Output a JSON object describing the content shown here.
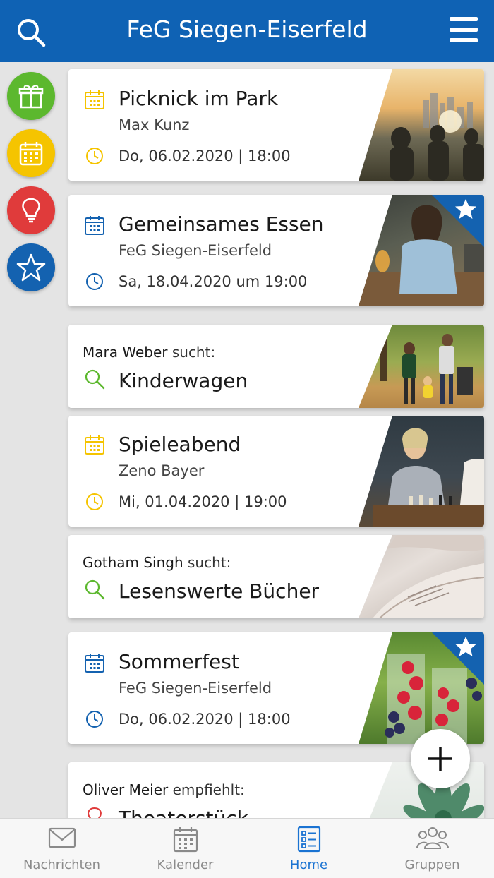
{
  "header": {
    "title": "FeG Siegen-Eiserfeld",
    "search_icon": "search-icon",
    "menu_icon": "hamburger-menu-icon"
  },
  "side_buttons": [
    {
      "name": "gift-icon",
      "color": "#5cb82e"
    },
    {
      "name": "calendar-icon",
      "color": "#f5c400"
    },
    {
      "name": "lightbulb-icon",
      "color": "#e03b3b"
    },
    {
      "name": "star-icon",
      "color": "#1462b0"
    }
  ],
  "cards": [
    {
      "type": "event",
      "title": "Picknick im Park",
      "subtitle": "Max Kunz",
      "date": "Do, 06.02.2020 | 18:00",
      "icon_color": "#f5c400",
      "featured": false
    },
    {
      "type": "event",
      "title": "Gemeinsames Essen",
      "subtitle": "FeG Siegen-Eiserfeld",
      "date": "Sa, 18.04.2020 um 19:00",
      "icon_color": "#1462b0",
      "featured": true
    },
    {
      "type": "search",
      "person": "Mara Weber",
      "suffix": "sucht:",
      "item": "Kinderwagen",
      "icon_color": "#5cb82e"
    },
    {
      "type": "event",
      "title": "Spieleabend",
      "subtitle": "Zeno Bayer",
      "date": "Mi, 01.04.2020 | 19:00",
      "icon_color": "#f5c400",
      "featured": false
    },
    {
      "type": "search",
      "person": "Gotham Singh",
      "suffix": "sucht:",
      "item": "Lesenswerte Bücher",
      "icon_color": "#5cb82e"
    },
    {
      "type": "event",
      "title": "Sommerfest",
      "subtitle": "FeG Siegen-Eiserfeld",
      "date": "Do, 06.02.2020 | 18:00",
      "icon_color": "#1462b0",
      "featured": true
    },
    {
      "type": "recommend",
      "person": "Oliver Meier",
      "suffix": "empfiehlt:",
      "item": "Theaterstück",
      "icon_color": "#e03b3b"
    }
  ],
  "fab": {
    "icon": "plus-icon"
  },
  "tabs": [
    {
      "label": "Nachrichten",
      "icon": "envelope-icon",
      "active": false
    },
    {
      "label": "Kalender",
      "icon": "calendar-icon",
      "active": false
    },
    {
      "label": "Home",
      "icon": "list-icon",
      "active": true
    },
    {
      "label": "Gruppen",
      "icon": "group-icon",
      "active": false
    }
  ],
  "colors": {
    "brand_blue": "#0f62b4",
    "active_tab": "#1a73d2",
    "inactive_tab": "#8a8a8a"
  }
}
